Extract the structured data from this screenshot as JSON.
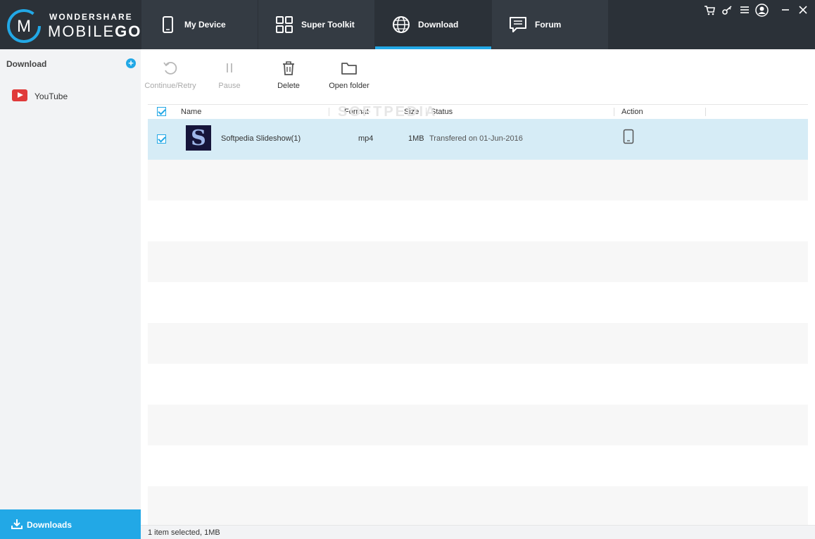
{
  "brand": {
    "top": "WONDERSHARE",
    "main_a": "MOBILE",
    "main_b": "GO"
  },
  "nav": {
    "tabs": [
      {
        "label": "My Device",
        "icon": "phone-icon"
      },
      {
        "label": "Super Toolkit",
        "icon": "grid-icon"
      },
      {
        "label": "Download",
        "icon": "globe-icon",
        "active": true
      },
      {
        "label": "Forum",
        "icon": "chat-icon"
      }
    ]
  },
  "window": {
    "controls": [
      "cart-icon",
      "key-icon",
      "menu-icon",
      "account-icon",
      "minimize-icon",
      "close-icon"
    ]
  },
  "sidebar": {
    "title": "Download",
    "items": [
      {
        "label": "YouTube",
        "icon": "youtube-icon"
      }
    ],
    "bottom_label": "Downloads"
  },
  "toolbar": {
    "continue_label": "Continue/Retry",
    "pause_label": "Pause",
    "delete_label": "Delete",
    "open_folder_label": "Open folder"
  },
  "table": {
    "columns": {
      "name": "Name",
      "format": "Format",
      "size": "Size",
      "status": "Status",
      "action": "Action"
    },
    "rows": [
      {
        "checked": true,
        "name": "Softpedia Slideshow(1)",
        "format": "mp4",
        "size": "1MB",
        "status": "Transfered on 01-Jun-2016",
        "action_icon": "device-icon"
      }
    ]
  },
  "status_bar": {
    "text": "1 item selected, 1MB"
  },
  "watermark": "SOFTPEDIA",
  "colors": {
    "accent": "#22a8e6",
    "topbar": "#2b3138",
    "tab": "#343b43",
    "selected_row": "#d6ecf6"
  }
}
